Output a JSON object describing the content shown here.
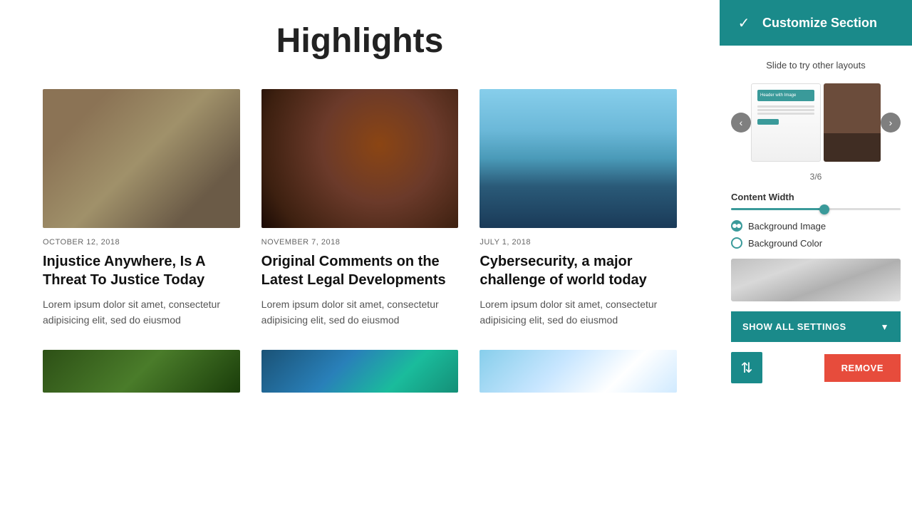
{
  "page": {
    "title": "Highlights"
  },
  "sidebar": {
    "title": "Customize Section",
    "instruction": "Slide to try other layouts",
    "layout_counter": "3/6",
    "content_width_label": "Content Width",
    "background_image_label": "Background Image",
    "background_color_label": "Background Color",
    "show_settings_label": "SHOW ALL SETTINGS",
    "remove_label": "REMOVE",
    "selected_option": "background_image"
  },
  "articles": [
    {
      "date": "OCTOBER 12, 2018",
      "title": "Injustice Anywhere, Is A Threat To Justice Today",
      "excerpt": "Lorem ipsum dolor sit amet, consectetur adipisicing elit, sed do eiusmod",
      "image_class": "img-business"
    },
    {
      "date": "NOVEMBER 7, 2018",
      "title": "Original Comments on the Latest Legal Developments",
      "excerpt": "Lorem ipsum dolor sit amet, consectetur adipisicing elit, sed do eiusmod",
      "image_class": "img-gavel"
    },
    {
      "date": "JULY 1, 2018",
      "title": "Cybersecurity, a major challenge of world today",
      "excerpt": "Lorem ipsum dolor sit amet, consectetur adipisicing elit, sed do eiusmod",
      "image_class": "img-buildings"
    }
  ],
  "bottom_images": [
    {
      "image_class": "img-4"
    },
    {
      "image_class": "img-5"
    },
    {
      "image_class": "img-6"
    }
  ]
}
